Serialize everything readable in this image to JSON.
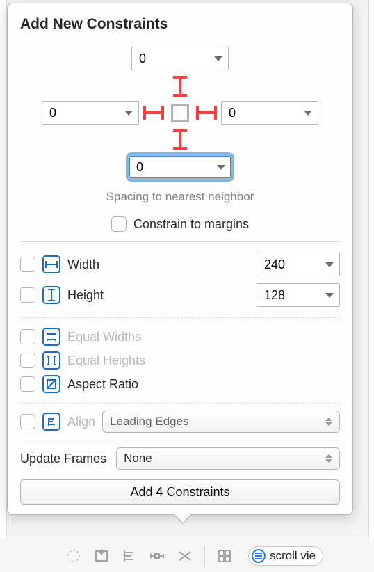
{
  "header": {
    "title": "Add New Constraints"
  },
  "spacing": {
    "top": "0",
    "left": "0",
    "right": "0",
    "bottom": "0",
    "caption": "Spacing to nearest neighbor",
    "constrain_to_margins": "Constrain to margins"
  },
  "size": {
    "width_label": "Width",
    "width_value": "240",
    "height_label": "Height",
    "height_value": "128"
  },
  "equal": {
    "widths": "Equal Widths",
    "heights": "Equal Heights",
    "aspect": "Aspect Ratio"
  },
  "align": {
    "label": "Align",
    "value": "Leading Edges"
  },
  "update": {
    "label": "Update Frames",
    "value": "None"
  },
  "action": {
    "add": "Add 4 Constraints"
  },
  "toolbar": {
    "pill": "scroll vie"
  }
}
